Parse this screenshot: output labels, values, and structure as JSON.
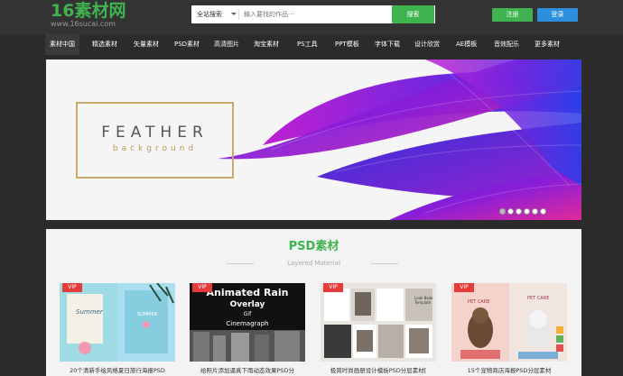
{
  "header": {
    "logo_main": "16素材网",
    "logo_sub": "www.16sucai.com",
    "search_select": "全站搜索",
    "search_placeholder": "输入要找的作品···",
    "search_button": "搜索",
    "register": "注册",
    "login": "登录"
  },
  "nav": {
    "items": [
      {
        "label": "素材中国"
      },
      {
        "label": "精选素材"
      },
      {
        "label": "矢量素材"
      },
      {
        "label": "PSD素材"
      },
      {
        "label": "高清图片"
      },
      {
        "label": "淘宝素材"
      },
      {
        "label": "PS工具"
      },
      {
        "label": "PPT模板"
      },
      {
        "label": "字体下载"
      },
      {
        "label": "设计欣赏"
      },
      {
        "label": "AE模板"
      },
      {
        "label": "音效配乐"
      },
      {
        "label": "更多素材"
      }
    ]
  },
  "banner": {
    "title": "FEATHER",
    "subtitle": "background"
  },
  "section": {
    "title": "PSD素材",
    "subtitle": "Layered Material",
    "cards": [
      {
        "badge": "VIP",
        "caption": "20个清新手绘风格夏日旅行海报PSD",
        "image_text": [
          "Summer",
          "SUMMER"
        ]
      },
      {
        "badge": "VIP",
        "caption": "给照片添加逼真下雨动态效果PSD分",
        "image_text": [
          "Animated Rain",
          "Overlay",
          "Gif",
          "Cinemagraph"
        ]
      },
      {
        "badge": "VIP",
        "caption": "极简时尚画册设计模板PSD分层素材[",
        "image_text": [
          "Look Book Template"
        ]
      },
      {
        "badge": "VIP",
        "caption": "15个宠物商店海报PSD分层素材",
        "image_text": [
          "PET CARE",
          "PET CARE"
        ]
      }
    ]
  },
  "colors": {
    "brand_green": "#3fb34f",
    "login_blue": "#2d8ede",
    "vip_red": "#e53b3b",
    "header_bg": "#333333",
    "nav_bg": "#2b2b2b"
  }
}
